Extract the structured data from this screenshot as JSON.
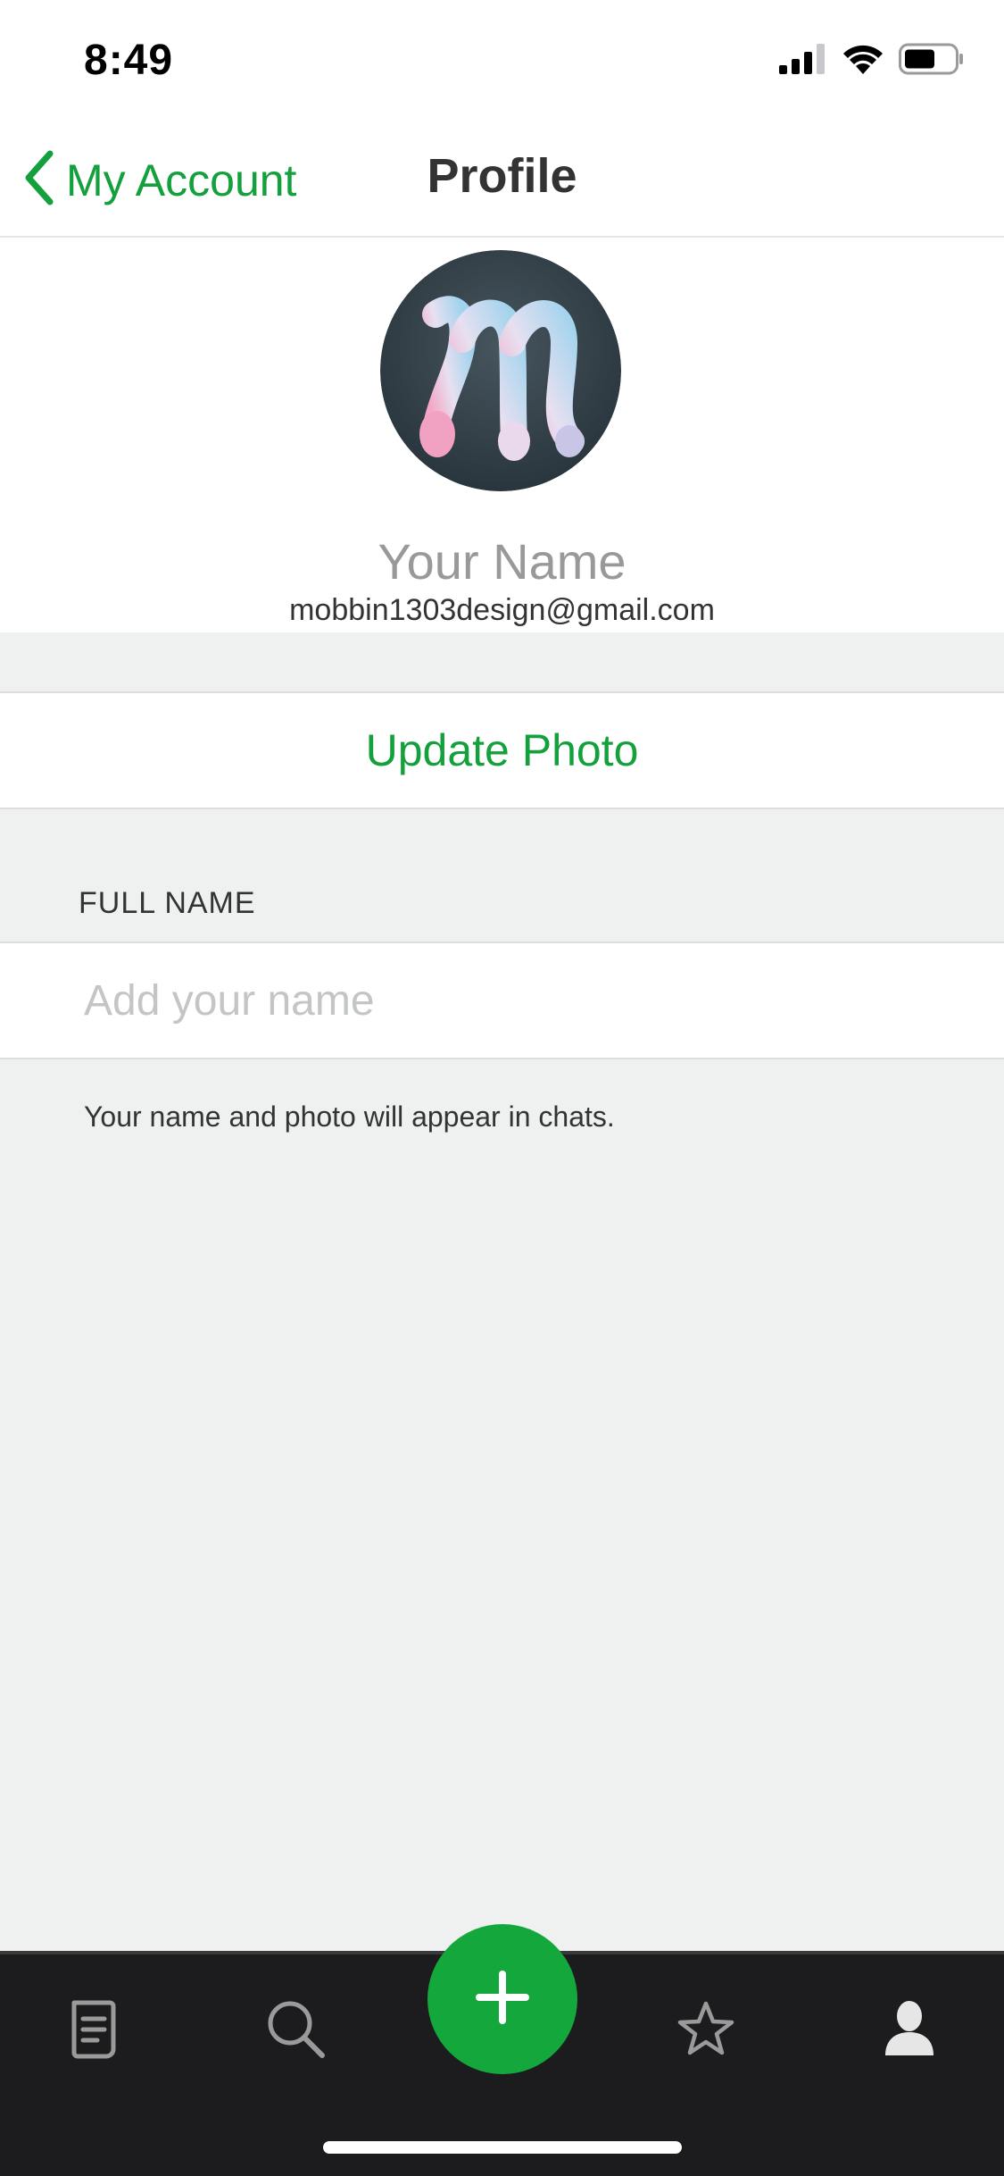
{
  "status_bar": {
    "time": "8:49",
    "icons": [
      "cellular-signal-icon",
      "wifi-icon",
      "battery-icon"
    ]
  },
  "nav": {
    "back_label": "My Account",
    "title": "Profile"
  },
  "profile": {
    "display_name": "Your Name",
    "email": "mobbin1303design@gmail.com"
  },
  "update_photo": {
    "label": "Update Photo"
  },
  "full_name": {
    "section_label": "FULL NAME",
    "value": "",
    "placeholder": "Add your name",
    "helper_text": "Your name and photo will appear in chats."
  },
  "tab_bar": {
    "items": [
      "notes-icon",
      "search-icon",
      "add-icon",
      "star-icon",
      "profile-icon"
    ],
    "active": "profile-icon"
  },
  "colors": {
    "accent": "#14a03c",
    "tab_bar_bg": "#1c1c1e",
    "page_bg": "#eff0f0"
  }
}
